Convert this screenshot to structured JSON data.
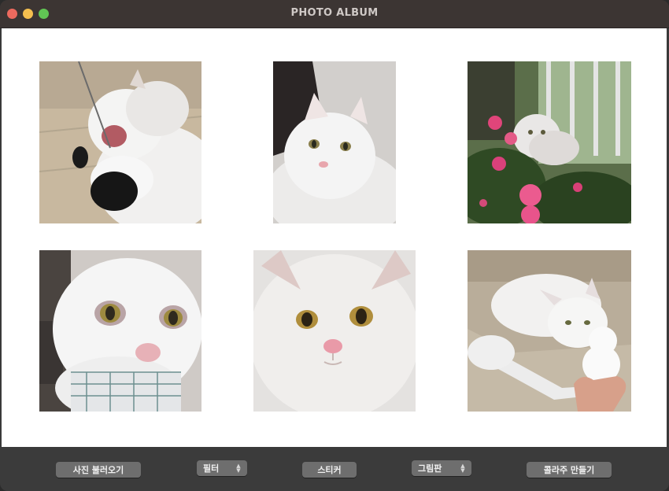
{
  "window": {
    "title": "PHOTO ALBUM"
  },
  "photos": [
    {
      "icon": "cat-playing-photo"
    },
    {
      "icon": "cat-lying-photo"
    },
    {
      "icon": "cat-with-flowers-photo"
    },
    {
      "icon": "cat-closeup-photo"
    },
    {
      "icon": "cat-portrait-photo"
    },
    {
      "icon": "cat-snowball-photo"
    }
  ],
  "toolbar": {
    "load_photos": "사진 불러오기",
    "filter_label": "필터",
    "sticker": "스티커",
    "drawing_label": "그림판",
    "collage": "콜라주 만들기"
  },
  "colors": {
    "titlebar": "#3c3533",
    "toolbar": "#3b3b3b",
    "button": "#6e6e6e"
  }
}
